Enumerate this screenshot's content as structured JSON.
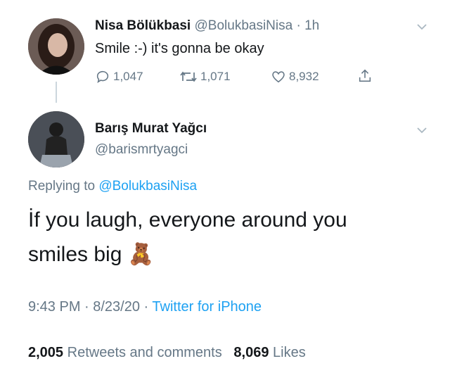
{
  "parent_tweet": {
    "display_name": "Nisa Bölükbasi",
    "handle": "@BolukbasiNisa",
    "separator": "·",
    "time_ago": "1h",
    "text": "Smile :-) it's gonna be okay",
    "actions": {
      "replies": "1,047",
      "retweets": "1,071",
      "likes": "8,932"
    },
    "icons": [
      "reply-icon",
      "retweet-icon",
      "like-icon",
      "share-icon",
      "chevron-down-icon"
    ]
  },
  "reply_tweet": {
    "display_name": "Barış Murat Yağcı",
    "handle": "@barismrtyagci",
    "replying_prefix": "Replying to",
    "replying_to": "@BolukbasiNisa",
    "text_line1": "İf you laugh, everyone around you",
    "text_line2": "smiles big",
    "emoji": "🧸",
    "time": "9:43 PM · 8/23/20 ·",
    "source": "Twitter for iPhone",
    "stats": {
      "retweets_count": "2,005",
      "retweets_label": "Retweets and comments",
      "likes_count": "8,069",
      "likes_label": "Likes"
    }
  },
  "colors": {
    "link": "#1da1f2",
    "muted": "#657786",
    "text": "#14171a"
  }
}
